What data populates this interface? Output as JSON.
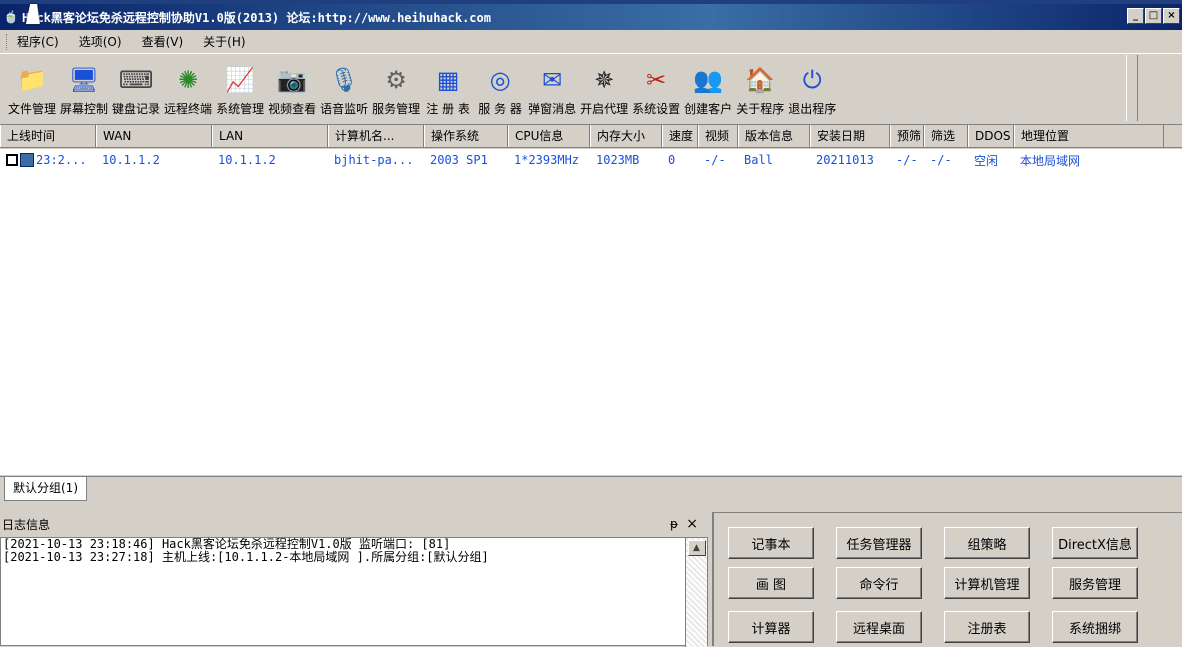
{
  "window": {
    "title": "Hack黑客论坛免杀远程控制协助V1.0版(2013)  论坛:http://www.heihuhack.com",
    "controls": [
      "_",
      "□",
      "×"
    ]
  },
  "menu": [
    "程序(C)",
    "选项(O)",
    "查看(V)",
    "关于(H)"
  ],
  "toolbar": [
    {
      "label": "文件管理",
      "icon": "folder-icon",
      "glyph": "📁",
      "color": "#2a6fb0"
    },
    {
      "label": "屏幕控制",
      "icon": "monitor-icon",
      "glyph": "🖥",
      "color": "#1a4fd8"
    },
    {
      "label": "键盘记录",
      "icon": "keyboard-icon",
      "glyph": "⌨",
      "color": "#444444"
    },
    {
      "label": "远程终端",
      "icon": "terminal-icon",
      "glyph": "✺",
      "color": "#2a8a2a"
    },
    {
      "label": "系统管理",
      "icon": "system-monitor-icon",
      "glyph": "📈",
      "color": "#1a4fd8"
    },
    {
      "label": "视频查看",
      "icon": "webcam-icon",
      "glyph": "📷",
      "color": "#404040"
    },
    {
      "label": "语音监听",
      "icon": "microphone-icon",
      "glyph": "🎙",
      "color": "#2a6fb0"
    },
    {
      "label": "服务管理",
      "icon": "gears-icon",
      "glyph": "⚙",
      "color": "#606060"
    },
    {
      "label": "注 册 表",
      "icon": "registry-icon",
      "glyph": "▦",
      "color": "#1a4fd8"
    },
    {
      "label": "服 务 器",
      "icon": "server-icon",
      "glyph": "◎",
      "color": "#1a4fd8"
    },
    {
      "label": "弹窗消息",
      "icon": "message-icon",
      "glyph": "✉",
      "color": "#1a4fd8"
    },
    {
      "label": "开启代理",
      "icon": "proxy-icon",
      "glyph": "✵",
      "color": "#202020"
    },
    {
      "label": "系统设置",
      "icon": "tools-icon",
      "glyph": "✂",
      "color": "#c02020"
    },
    {
      "label": "创建客户",
      "icon": "users-icon",
      "glyph": "👥",
      "color": "#303030"
    },
    {
      "label": "关于程序",
      "icon": "home-icon",
      "glyph": "🏠",
      "color": "#d07020"
    },
    {
      "label": "退出程序",
      "icon": "power-icon",
      "glyph": "⏻",
      "color": "#1a4fd8"
    }
  ],
  "columns": [
    "上线时间",
    "WAN",
    "LAN",
    "计算机名...",
    "操作系统",
    "CPU信息",
    "内存大小",
    "速度",
    "视频",
    "版本信息",
    "安装日期",
    "预筛",
    "筛选",
    "DDOS",
    "地理位置"
  ],
  "rows": [
    {
      "cells": [
        "23:2...",
        "10.1.1.2",
        "10.1.1.2",
        "bjhit-pa...",
        "2003 SP1",
        "1*2393MHz",
        "1023MB",
        "0",
        "-/-",
        "Ball",
        "20211013",
        "-/-",
        "-/-",
        "空闲",
        "本地局域网"
      ]
    }
  ],
  "groups": [
    "默认分组(1)"
  ],
  "log": {
    "title": "日志信息",
    "pin": "ᵽ",
    "close": "×",
    "lines": [
      "[2021-10-13 23:18:46]   Hack黑客论坛免杀远程控制V1.0版  监听端口: [81]",
      "[2021-10-13 23:27:18]   主机上线:[10.1.1.2-本地局域网 ].所属分组:[默认分组]"
    ],
    "scroll_up": "▲"
  },
  "actions": [
    "记事本",
    "任务管理器",
    "组策略",
    "DirectX信息",
    "画  图",
    "命令行",
    "计算机管理",
    "服务管理",
    "计算器",
    "远程桌面",
    "注册表",
    "系统捆绑"
  ]
}
